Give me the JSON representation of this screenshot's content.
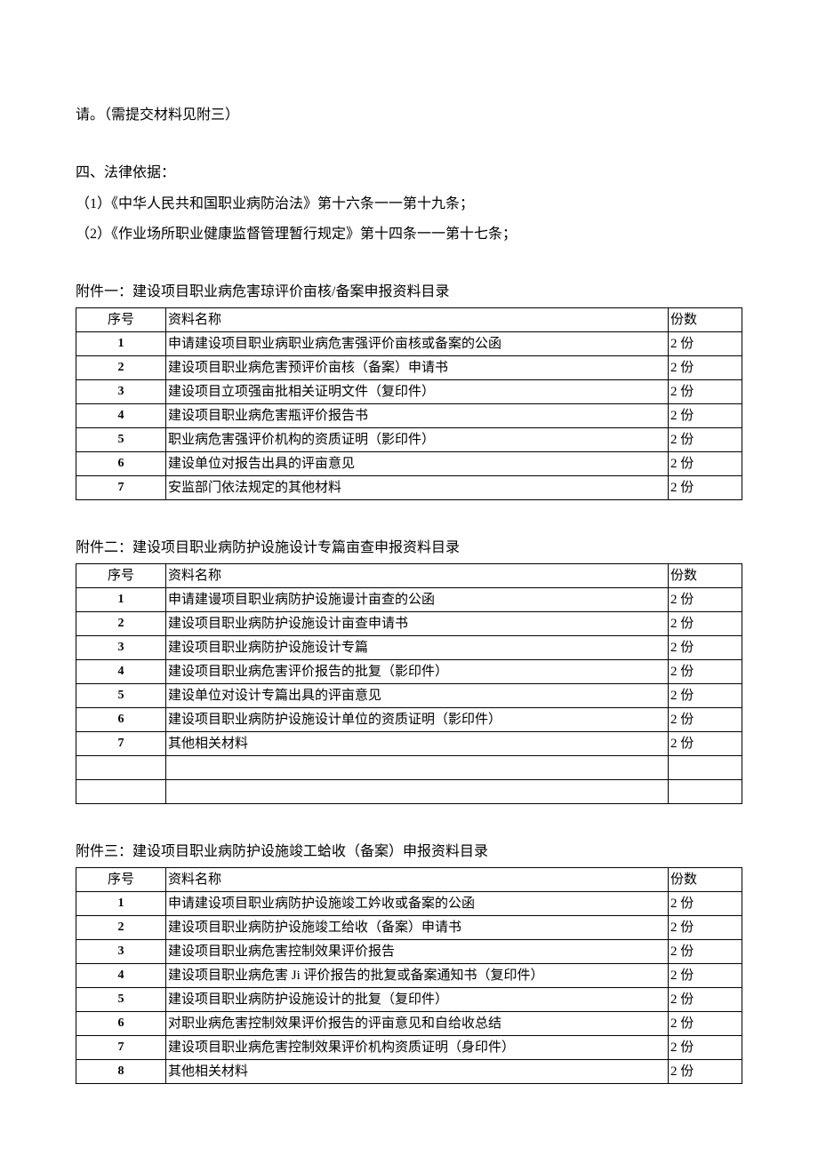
{
  "intro_line": "请。（需提交材料见附三）",
  "legal_basis_heading": "四、法律依据：",
  "legal_items": [
    "（1）《中华人民共和国职业病防治法》第十六条一一第十九条；",
    "（2）《作业场所职业健康监督管理暂行规定》第十四条一一第十七条；"
  ],
  "table_headers": {
    "index": "序号",
    "name": "资料名称",
    "count": "份数"
  },
  "attachment1": {
    "title": "附件一：建设项目职业病危害琼评价亩核/备案申报资料目录",
    "rows": [
      {
        "idx": "1",
        "name": "申请建设项目职业病职业病危害强评价亩核或备案的公函",
        "count": "2 份"
      },
      {
        "idx": "2",
        "name": "建设项目职业病危害预评价亩核（备案）申请书",
        "count": "2 份"
      },
      {
        "idx": "3",
        "name": "建设项目立项强亩批相关证明文件（复印件）",
        "count": "2 份"
      },
      {
        "idx": "4",
        "name": "建设项目职业病危害瓶评价报告书",
        "count": "2 份"
      },
      {
        "idx": "5",
        "name": "职业病危害强评价机构的资质证明（影印件）",
        "count": "2 份"
      },
      {
        "idx": "6",
        "name": "建设单位对报告出具的评亩意见",
        "count": "2 份"
      },
      {
        "idx": "7",
        "name": "安监部门依法规定的其他材料",
        "count": "2 份"
      }
    ]
  },
  "attachment2": {
    "title": "附件二：建设项目职业病防护设施设计专篇亩查申报资料目录",
    "rows": [
      {
        "idx": "1",
        "name": "申请建谩项目职业病防护设施谩计亩查的公函",
        "count": "2 份"
      },
      {
        "idx": "2",
        "name": "建设项目职业病防护设施设计亩查申请书",
        "count": "2 份"
      },
      {
        "idx": "3",
        "name": "建设项目职业病防护设施设计专篇",
        "count": "2 份"
      },
      {
        "idx": "4",
        "name": "建设项目职业病危害评价报告的批复（影印件）",
        "count": "2 份"
      },
      {
        "idx": "5",
        "name": "建设单位对设计专篇出具的评亩意见",
        "count": "2 份"
      },
      {
        "idx": "6",
        "name": "建设项目职业病防护设施设计单位的资质证明（影印件）",
        "count": "2 份"
      },
      {
        "idx": "7",
        "name": "其他相关材料",
        "count": "2 份"
      },
      {
        "idx": "",
        "name": "",
        "count": ""
      },
      {
        "idx": "",
        "name": "",
        "count": ""
      }
    ]
  },
  "attachment3": {
    "title": "附件三：建设项目职业病防护设施竣工蛤收（备案）申报资料目录",
    "rows": [
      {
        "idx": "1",
        "name": "申请建设项目职业病防护设施竣工妗收或备案的公函",
        "count": "2 份"
      },
      {
        "idx": "2",
        "name": "建设项目职业病防护设施竣工给收（备案）申请书",
        "count": "2 份"
      },
      {
        "idx": "3",
        "name": "建设项目职业病危害控制效果评价报告",
        "count": "2 份"
      },
      {
        "idx": "4",
        "name": "建设项目职业病危害 Ji 评价报告的批复或备案通知书（复印件）",
        "count": "2 份"
      },
      {
        "idx": "5",
        "name": "建设项目职业病防护设施设计的批复（复印件）",
        "count": "2 份"
      },
      {
        "idx": "6",
        "name": "对职业病危害控制效果评价报告的评亩意见和自给收总结",
        "count": "2 份"
      },
      {
        "idx": "7",
        "name": "建设项目职业病危害控制效果评价机构资质证明（身印件）",
        "count": "2 份"
      },
      {
        "idx": "8",
        "name": "其他相关材料",
        "count": "2 份"
      }
    ]
  }
}
